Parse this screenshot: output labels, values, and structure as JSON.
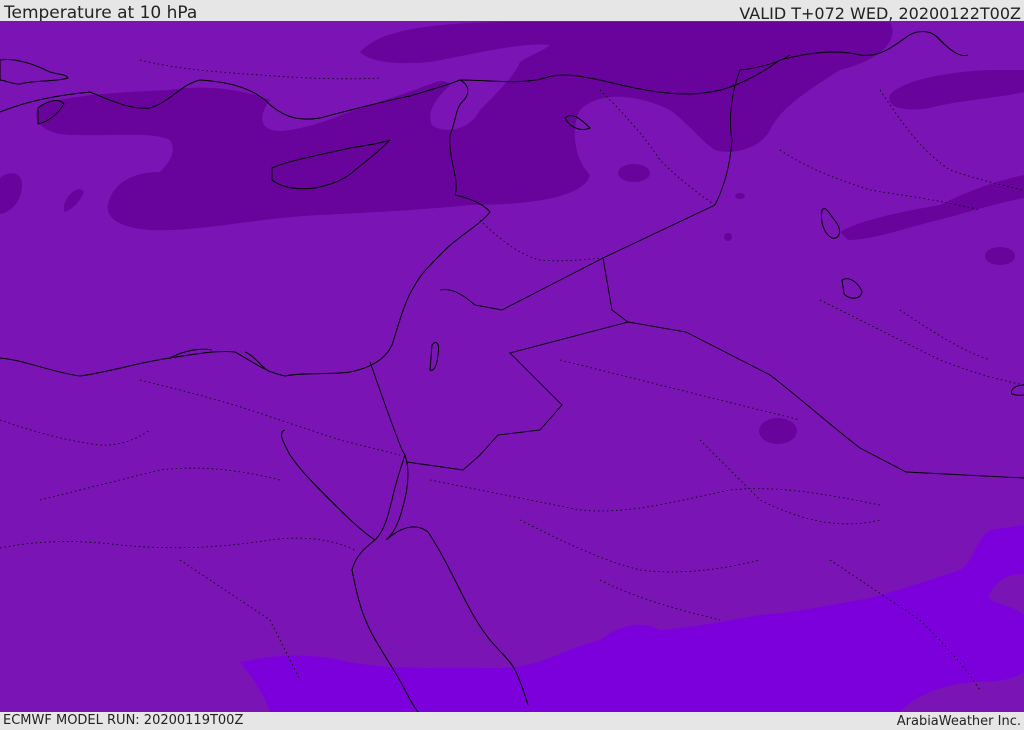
{
  "header": {
    "title": "Temperature at 10 hPa",
    "valid_time": "VALID T+072 WED, 20200122T00Z"
  },
  "footer": {
    "model_run": "ECMWF MODEL RUN: 20200119T00Z",
    "credit": "ArabiaWeather Inc."
  },
  "map": {
    "colors": {
      "warm_band": "#7a14b4",
      "cold_band": "#68049c",
      "warmest_band": "#7c00dc",
      "coastline": "#000000",
      "border": "#000000"
    }
  }
}
